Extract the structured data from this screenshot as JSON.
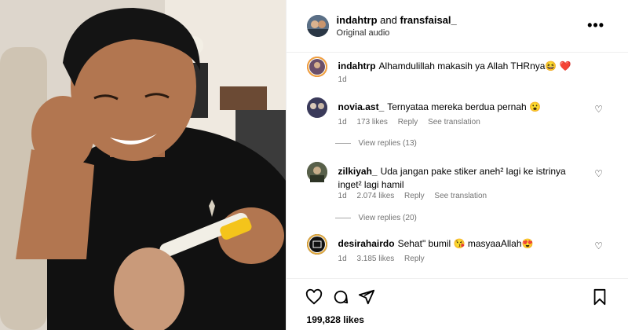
{
  "header": {
    "user1": "indahtrp",
    "joiner": "and",
    "user2": "fransfaisal_",
    "subtitle": "Original audio",
    "more_label": "•••"
  },
  "caption": {
    "username": "indahtrp",
    "text": "Alhamdulillah makasih ya Allah THRnya😆 ❤️",
    "time": "1d"
  },
  "comments": [
    {
      "username": "novia.ast_",
      "text": "Ternyataa mereka berdua pernah 😮",
      "time": "1d",
      "likes": "173 likes",
      "reply": "Reply",
      "translate": "See translation",
      "view_replies": "View replies (13)"
    },
    {
      "username": "zilkiyah_",
      "text": "Uda jangan pake stiker aneh² lagi ke istrinya inget² lagi hamil",
      "time": "1d",
      "likes": "2.074 likes",
      "reply": "Reply",
      "translate": "See translation",
      "view_replies": "View replies (20)"
    },
    {
      "username": "desirahairdo",
      "text": "Sehat\" bumil 😘 masyaaAllah😍",
      "time": "1d",
      "likes": "3.185 likes",
      "reply": "Reply"
    }
  ],
  "footer": {
    "likes": "199,828 likes"
  },
  "icons": {
    "like": "heart-icon",
    "comment": "comment-icon",
    "share": "share-icon",
    "save": "bookmark-icon"
  }
}
